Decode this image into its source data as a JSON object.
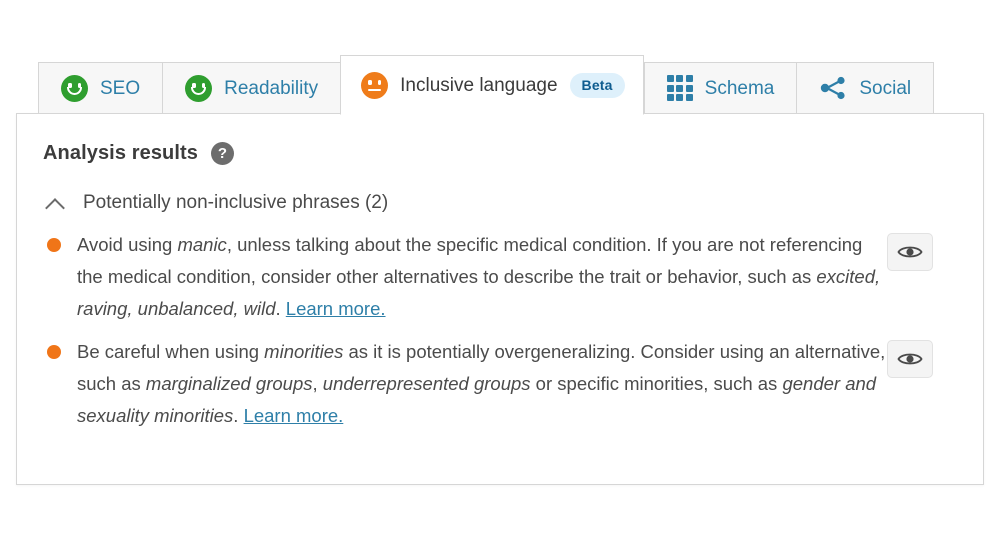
{
  "tabs": [
    {
      "label": "SEO",
      "icon": "happy-face-icon",
      "state": "good",
      "active": false
    },
    {
      "label": "Readability",
      "icon": "happy-face-icon",
      "state": "good",
      "active": false
    },
    {
      "label": "Inclusive language",
      "icon": "neutral-face-icon",
      "state": "ok",
      "active": true,
      "badge": "Beta"
    },
    {
      "label": "Schema",
      "icon": "grid-icon",
      "active": false
    },
    {
      "label": "Social",
      "icon": "share-icon",
      "active": false
    }
  ],
  "panel": {
    "title": "Analysis results",
    "help_icon_glyph": "?",
    "section": {
      "title": "Potentially non-inclusive phrases (2)",
      "collapse_icon": "chevron-up-icon",
      "expanded": true
    },
    "results": [
      {
        "severity_color": "#f07518",
        "segments": [
          {
            "text": "Avoid using ",
            "style": "normal"
          },
          {
            "text": "manic",
            "style": "italic"
          },
          {
            "text": ", unless talking about the specific medical condition. If you are not referencing the medical condition, consider other alternatives to describe the trait or behavior, such as ",
            "style": "normal"
          },
          {
            "text": "excited, raving, unbalanced, wild",
            "style": "italic"
          },
          {
            "text": ". ",
            "style": "normal"
          },
          {
            "text": "Learn more.",
            "style": "link"
          }
        ],
        "action_label": "eye-icon"
      },
      {
        "severity_color": "#f07518",
        "segments": [
          {
            "text": "Be careful when using ",
            "style": "normal"
          },
          {
            "text": "minorities",
            "style": "italic"
          },
          {
            "text": " as it is potentially overgeneralizing. Consider using an alternative, such as ",
            "style": "normal"
          },
          {
            "text": "marginalized groups",
            "style": "italic"
          },
          {
            "text": ", ",
            "style": "normal"
          },
          {
            "text": "underrepresented groups",
            "style": "italic"
          },
          {
            "text": " or specific minorities, such as ",
            "style": "normal"
          },
          {
            "text": "gender and sexuality minorities",
            "style": "italic"
          },
          {
            "text": ". ",
            "style": "normal"
          },
          {
            "text": "Learn more.",
            "style": "link"
          }
        ],
        "action_label": "eye-icon"
      }
    ]
  },
  "colors": {
    "good": "#2f9e2f",
    "warning": "#ef7c1a",
    "link": "#2e7fa8",
    "badge_bg": "#def0fb",
    "badge_text": "#0f5c8f",
    "bullet": "#f07518"
  }
}
